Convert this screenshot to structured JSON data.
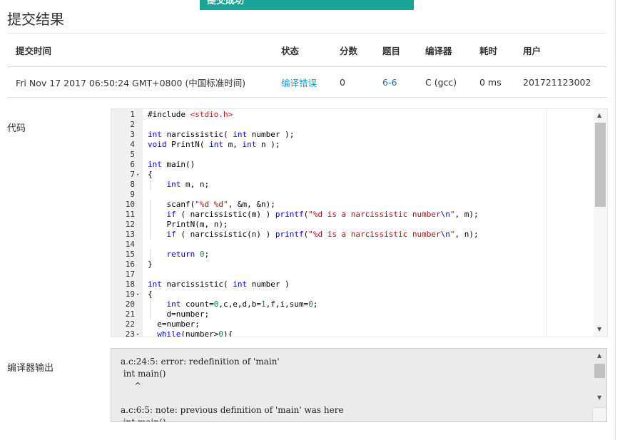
{
  "toast": {
    "text": "提交成功"
  },
  "page_title": "提交结果",
  "table": {
    "headers": [
      "提交时间",
      "状态",
      "分数",
      "题目",
      "编译器",
      "耗时",
      "用户"
    ],
    "row": {
      "time": "Fri Nov 17 2017 06:50:24 GMT+0800 (中国标准时间)",
      "status": "编译错误",
      "score": "0",
      "problem": "6-6",
      "compiler": "C (gcc)",
      "duration": "0 ms",
      "user": "201721123002"
    }
  },
  "code_label": "代码",
  "compiler_output_label": "编译器输出",
  "code": {
    "fold_marker": "▾",
    "lines": [
      {
        "n": "1",
        "indent": 0,
        "segs": [
          {
            "t": "#include ",
            "c": ""
          },
          {
            "t": "<stdio.h>",
            "c": "inc"
          }
        ]
      },
      {
        "n": "2",
        "indent": 0,
        "segs": []
      },
      {
        "n": "3",
        "indent": 0,
        "segs": [
          {
            "t": "int",
            "c": "kw"
          },
          {
            "t": " narcissistic( ",
            "c": ""
          },
          {
            "t": "int",
            "c": "kw"
          },
          {
            "t": " number );",
            "c": ""
          }
        ]
      },
      {
        "n": "4",
        "indent": 0,
        "segs": [
          {
            "t": "void",
            "c": "kw"
          },
          {
            "t": " PrintN( ",
            "c": ""
          },
          {
            "t": "int",
            "c": "kw"
          },
          {
            "t": " m, ",
            "c": ""
          },
          {
            "t": "int",
            "c": "kw"
          },
          {
            "t": " n );",
            "c": ""
          }
        ]
      },
      {
        "n": "5",
        "indent": 0,
        "segs": []
      },
      {
        "n": "6",
        "indent": 0,
        "segs": [
          {
            "t": "int",
            "c": "kw"
          },
          {
            "t": " main()",
            "c": ""
          }
        ]
      },
      {
        "n": "7",
        "indent": 0,
        "fold": true,
        "segs": [
          {
            "t": "{",
            "c": ""
          }
        ]
      },
      {
        "n": "8",
        "indent": 1,
        "segs": [
          {
            "t": "int",
            "c": "kw"
          },
          {
            "t": " m, n;",
            "c": ""
          }
        ]
      },
      {
        "n": "9",
        "indent": 0,
        "segs": []
      },
      {
        "n": "10",
        "indent": 1,
        "segs": [
          {
            "t": "scanf(",
            "c": ""
          },
          {
            "t": "\"%d %d\"",
            "c": "st"
          },
          {
            "t": ", &m, &n);",
            "c": ""
          }
        ]
      },
      {
        "n": "11",
        "indent": 1,
        "segs": [
          {
            "t": "if",
            "c": "kw"
          },
          {
            "t": " ( narcissistic(m) ) ",
            "c": ""
          },
          {
            "t": "printf",
            "c": "kw"
          },
          {
            "t": "(",
            "c": ""
          },
          {
            "t": "\"%d is a narcissistic number",
            "c": "st"
          },
          {
            "t": "\\n",
            "c": "esc"
          },
          {
            "t": "\"",
            "c": "st"
          },
          {
            "t": ", m);",
            "c": ""
          }
        ]
      },
      {
        "n": "12",
        "indent": 1,
        "segs": [
          {
            "t": "PrintN(m, n);",
            "c": ""
          }
        ]
      },
      {
        "n": "13",
        "indent": 1,
        "segs": [
          {
            "t": "if",
            "c": "kw"
          },
          {
            "t": " ( narcissistic(n) ) ",
            "c": ""
          },
          {
            "t": "printf",
            "c": "kw"
          },
          {
            "t": "(",
            "c": ""
          },
          {
            "t": "\"%d is a narcissistic number",
            "c": "st"
          },
          {
            "t": "\\n",
            "c": "esc"
          },
          {
            "t": "\"",
            "c": "st"
          },
          {
            "t": ", n);",
            "c": ""
          }
        ]
      },
      {
        "n": "14",
        "indent": 0,
        "segs": []
      },
      {
        "n": "15",
        "indent": 1,
        "segs": [
          {
            "t": "return",
            "c": "kw"
          },
          {
            "t": " ",
            "c": ""
          },
          {
            "t": "0",
            "c": "nm"
          },
          {
            "t": ";",
            "c": ""
          }
        ]
      },
      {
        "n": "16",
        "indent": 0,
        "segs": [
          {
            "t": "}",
            "c": ""
          }
        ]
      },
      {
        "n": "17",
        "indent": 0,
        "segs": []
      },
      {
        "n": "18",
        "indent": 0,
        "segs": [
          {
            "t": "int",
            "c": "kw"
          },
          {
            "t": " narcissistic( ",
            "c": ""
          },
          {
            "t": "int",
            "c": "kw"
          },
          {
            "t": " number )",
            "c": ""
          }
        ]
      },
      {
        "n": "19",
        "indent": 0,
        "fold": true,
        "segs": [
          {
            "t": "{",
            "c": ""
          }
        ]
      },
      {
        "n": "20",
        "indent": 1,
        "segs": [
          {
            "t": "int",
            "c": "kw"
          },
          {
            "t": " count=",
            "c": ""
          },
          {
            "t": "0",
            "c": "nm"
          },
          {
            "t": ",c,e,d,b=",
            "c": ""
          },
          {
            "t": "1",
            "c": "nm"
          },
          {
            "t": ",f,i,sum=",
            "c": ""
          },
          {
            "t": "0",
            "c": "nm"
          },
          {
            "t": ";",
            "c": ""
          }
        ]
      },
      {
        "n": "21",
        "indent": 1,
        "segs": [
          {
            "t": "d=number;",
            "c": ""
          }
        ]
      },
      {
        "n": "22",
        "indent": 0,
        "segs": [
          {
            "t": "  e=number;",
            "c": ""
          }
        ]
      },
      {
        "n": "23",
        "indent": 0,
        "fold": true,
        "segs": [
          {
            "t": "  ",
            "c": ""
          },
          {
            "t": "while",
            "c": "kw"
          },
          {
            "t": "(number>",
            "c": ""
          },
          {
            "t": "0",
            "c": "nm"
          },
          {
            "t": "){",
            "c": ""
          }
        ]
      }
    ]
  },
  "compiler_output": {
    "text": "a.c:24:5: error: redefinition of 'main'\n int main()\n     ^\n\na.c:6:5: note: previous definition of 'main' was here\n int main()\n     ^"
  }
}
